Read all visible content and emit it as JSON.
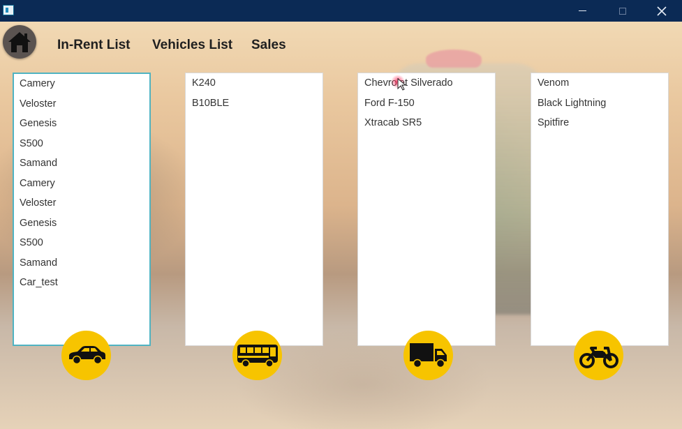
{
  "window": {
    "icons": {
      "minimize": "minimize-icon",
      "maximize": "maximize-icon",
      "close": "close-icon",
      "app": "app-icon"
    }
  },
  "nav": {
    "home_icon": "home-icon",
    "in_rent": "In-Rent List",
    "vehicles": "Vehicles List",
    "sales": "Sales"
  },
  "lists": {
    "cars": [
      "Camery",
      "Veloster",
      "Genesis",
      "S500",
      "Samand",
      "Camery",
      "Veloster",
      "Genesis",
      "S500",
      "Samand",
      "Car_test"
    ],
    "buses": [
      "K240",
      "B10BLE"
    ],
    "trucks": [
      "Chevrolet Silverado",
      "Ford F-150",
      "Xtracab SR5"
    ],
    "motorcycles": [
      "Venom",
      "Black Lightning",
      "Spitfire"
    ]
  },
  "categories": {
    "car_icon": "car-icon",
    "bus_icon": "bus-icon",
    "truck_icon": "truck-icon",
    "motorcycle_icon": "motorcycle-icon",
    "color": "#f7c400"
  }
}
